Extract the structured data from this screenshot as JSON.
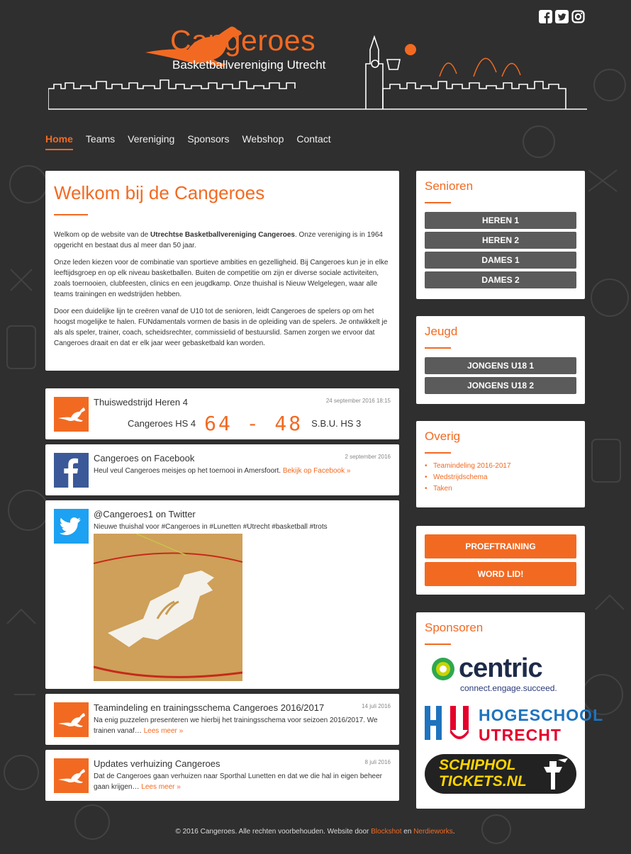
{
  "brand": {
    "title": "Cangeroes",
    "subtitle": "Basketballvereniging Utrecht"
  },
  "social": [
    "facebook-icon",
    "twitter-icon",
    "instagram-icon"
  ],
  "nav": [
    "Home",
    "Teams",
    "Vereniging",
    "Sponsors",
    "Webshop",
    "Contact"
  ],
  "welcome": {
    "title": "Welkom bij de Cangeroes",
    "p1_a": "Welkom op de website van de ",
    "p1_b": "Utrechtse Basketballvereniging Cangeroes",
    "p1_c": ". Onze vereniging is in 1964 opgericht en bestaat dus al meer dan 50 jaar.",
    "p2": "Onze leden kiezen voor de combinatie van sportieve ambities en gezelligheid. Bij Cangeroes kun je in elke leeftijdsgroep en op elk niveau basketballen. Buiten de competitie om zijn er diverse sociale activiteiten, zoals toernooien, clubfeesten, clinics en een jeugdkamp. Onze thuishal is Nieuw Welgelegen, waar alle teams trainingen en wedstrijden hebben.",
    "p3": "Door een duidelijke lijn te creëren vanaf de U10 tot de senioren, leidt Cangeroes de spelers op om het hoogst mogelijke te halen. FUNdamentals vormen de basis in de opleiding van de spelers. Je ontwikkelt je als als speler, trainer, coach, scheidsrechter, commissielid of bestuurslid. Samen zorgen we ervoor dat Cangeroes draait en dat er elk jaar weer gebasketbald kan worden."
  },
  "posts": [
    {
      "title": "Thuiswedstrijd Heren 4",
      "date": "24 september 2016 18:15",
      "home": "Cangeroes",
      "home_team": "HS 4",
      "score": "64 - 48",
      "away": "S.B.U. HS 3"
    },
    {
      "title": "Cangeroes on Facebook",
      "date": "2 september 2016",
      "text": "Heul veul Cangeroes meisjes op het toernooi in Amersfoort.",
      "link": "Bekijk op Facebook »"
    },
    {
      "title": "@Cangeroes1 on Twitter",
      "text": "Nieuwe thuishal voor #Cangeroes in #Lunetten #Utrecht #basketball #trots"
    },
    {
      "title": "Teamindeling en trainingsschema Cangeroes 2016/2017",
      "date": "14 juli 2016",
      "text": "Na enig puzzelen presenteren we hierbij het trainingsschema voor seizoen 2016/2017. We trainen vanaf…",
      "link": "Lees meer »"
    },
    {
      "title": "Updates verhuizing Cangeroes",
      "date": "8 juli 2016",
      "text": "Dat de Cangeroes gaan verhuizen naar Sporthal Lunetten en dat we die hal in eigen beheer gaan krijgen…",
      "link": "Lees meer »"
    }
  ],
  "sidebar": {
    "senioren": {
      "title": "Senioren",
      "buttons": [
        "HEREN 1",
        "HEREN 2",
        "DAMES 1",
        "DAMES 2"
      ]
    },
    "jeugd": {
      "title": "Jeugd",
      "buttons": [
        "JONGENS U18 1",
        "JONGENS U18 2"
      ]
    },
    "overig": {
      "title": "Overig",
      "links": [
        "Teamindeling 2016-2017",
        "Wedstrijdschema",
        "Taken"
      ]
    },
    "cta": [
      "PROEFTRAINING",
      "WORD LID!"
    ],
    "sponsoren": {
      "title": "Sponsoren"
    }
  },
  "sponsors": {
    "centric_name": "centric",
    "centric_tag": "connect.engage.succeed.",
    "hu_line1": "HOGESCHOOL",
    "hu_line2": "UTRECHT",
    "schiphol_line1": "SCHIPHOL",
    "schiphol_line2": "TICKETS.NL"
  },
  "footer": {
    "text": "© 2016 Cangeroes. Alle rechten voorbehouden. Website door ",
    "link1": "Blockshot",
    "mid": " en ",
    "link2": "Nerdieworks",
    "end": "."
  },
  "colors": {
    "accent": "#f26a22",
    "dark_button": "#5b5b5b",
    "background": "#2f2f2f",
    "facebook": "#3b5998",
    "twitter": "#1da1f2"
  }
}
